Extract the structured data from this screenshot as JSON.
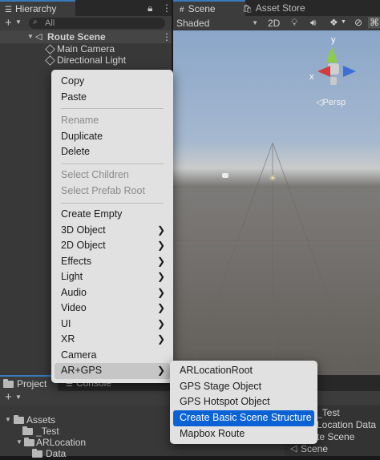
{
  "hierarchy": {
    "tab": "Hierarchy",
    "search_placeholder": "All",
    "scene_name": "Route Scene",
    "items": [
      "Main Camera",
      "Directional Light"
    ]
  },
  "scene_view": {
    "tabs": [
      "Scene",
      "Asset Store"
    ],
    "shading": "Shaded",
    "mode_2d": "2D",
    "gizmo": {
      "x": "x",
      "y": "y",
      "view": "Persp"
    }
  },
  "project": {
    "tabs": [
      "Project",
      "Console"
    ],
    "tree": [
      "Assets",
      "_Test",
      "ARLocation",
      "Data"
    ],
    "right_items": [
      "_Test",
      "Location Data",
      "te Scene",
      "Scene"
    ]
  },
  "context_menu": {
    "group1": [
      "Copy",
      "Paste"
    ],
    "group2": [
      "Rename",
      "Duplicate",
      "Delete"
    ],
    "group3": [
      "Select Children",
      "Select Prefab Root"
    ],
    "group4": [
      "Create Empty",
      "3D Object",
      "2D Object",
      "Effects",
      "Light",
      "Audio",
      "Video",
      "UI",
      "XR",
      "Camera",
      "AR+GPS"
    ],
    "disabled": [
      "Rename",
      "Select Children",
      "Select Prefab Root"
    ]
  },
  "submenu": {
    "items": [
      "ARLocationRoot",
      "GPS Stage Object",
      "GPS Hotspot Object",
      "Create Basic Scene Structure",
      "Mapbox Route"
    ],
    "highlighted": "Create Basic Scene Structure"
  },
  "colors": {
    "highlight": "#0a62d4",
    "accent": "#3a79bb",
    "menu_bg": "#e1e1e1"
  }
}
